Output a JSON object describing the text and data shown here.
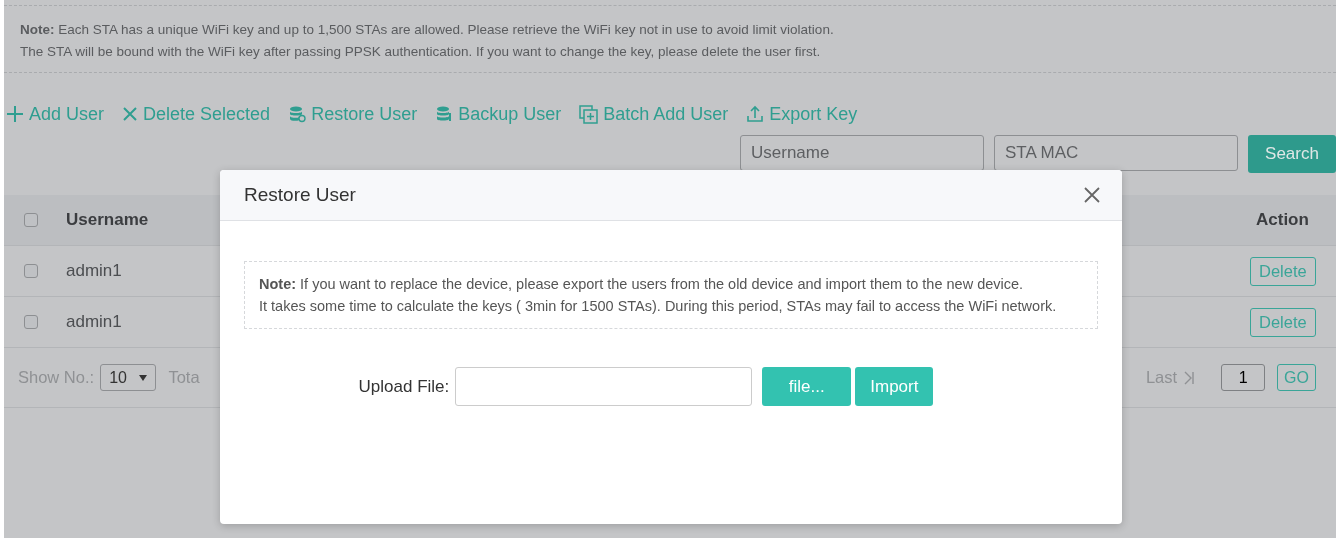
{
  "note": {
    "lines": [
      "**Note:** Each STA has a unique WiFi key and up to 1,500 STAs are allowed. Please retrieve the WiFi key not in use to avoid limit violation.",
      "The STA will be bound with the WiFi key after passing PPSK authentication. If you want to change the key, please delete the user first."
    ]
  },
  "toolbar": [
    {
      "kind": "add",
      "label": "Add User"
    },
    {
      "kind": "delete",
      "label": "Delete Selected"
    },
    {
      "kind": "restore",
      "label": "Restore User"
    },
    {
      "kind": "backup",
      "label": "Backup User"
    },
    {
      "kind": "batch",
      "label": "Batch Add User"
    },
    {
      "kind": "export",
      "label": "Export Key"
    }
  ],
  "search": {
    "fields": [
      {
        "placeholder": "Username"
      },
      {
        "placeholder": "STA MAC"
      }
    ],
    "button": "Search"
  },
  "table": {
    "select_all": {
      "checked": false
    },
    "columns": [
      "Username",
      "Action"
    ],
    "rows": [
      {
        "checked": false,
        "username": "admin1",
        "action": "Delete"
      },
      {
        "checked": false,
        "username": "admin1",
        "action": "Delete"
      }
    ]
  },
  "pager": {
    "show_label": "Show No.:",
    "page_size": "10",
    "total_label": "Tota",
    "last_label": "Last",
    "page": "1",
    "go": "GO"
  },
  "dialog": {
    "title": "Restore User",
    "note": [
      "**Note:** If you want to replace the device, please export the users from the old device and import them to the new device.",
      "It takes some time to calculate the keys ( 3min for 1500 STAs). During this period, STAs may fail to access the WiFi network."
    ],
    "upload_label": "Upload File:",
    "file_button": "file...",
    "import_button": "Import"
  }
}
